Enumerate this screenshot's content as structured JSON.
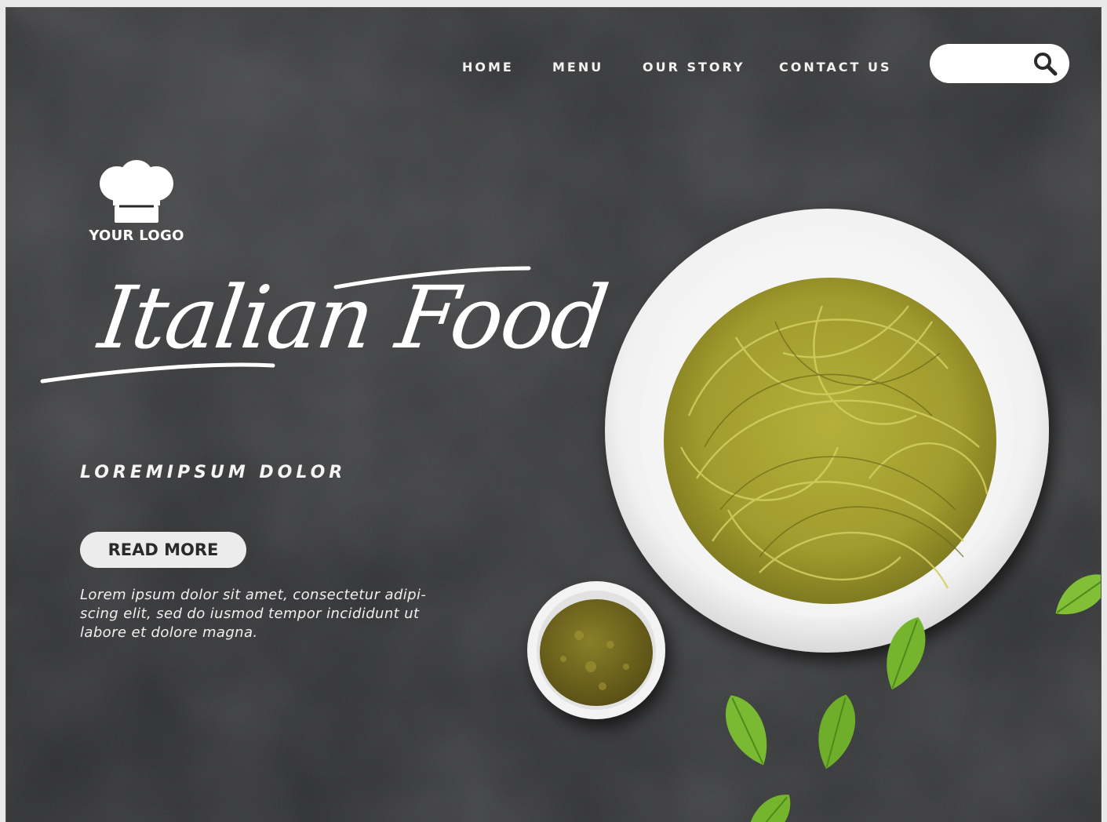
{
  "nav": {
    "items": [
      {
        "label": "HOME"
      },
      {
        "label": "MENU"
      },
      {
        "label": "OUR STORY"
      },
      {
        "label": "CONTACT US"
      }
    ]
  },
  "search": {
    "value": "",
    "placeholder": "",
    "icon": "search-icon"
  },
  "logo": {
    "icon": "chef-hat-icon",
    "text": "YOUR LOGO"
  },
  "hero": {
    "title": "Italian Food",
    "subtitle": "LOREMIPSUM DOLOR",
    "button_label": "READ MORE",
    "description": "Lorem ipsum dolor sit amet, consectetur adipi-scing elit, sed do iusmod tempor incididunt ut labore et dolore magna."
  },
  "colors": {
    "background": "#262729",
    "text": "#ffffff",
    "button": "#ececec",
    "pesto": "#9a9a2c",
    "basil": "#6fae2a"
  }
}
